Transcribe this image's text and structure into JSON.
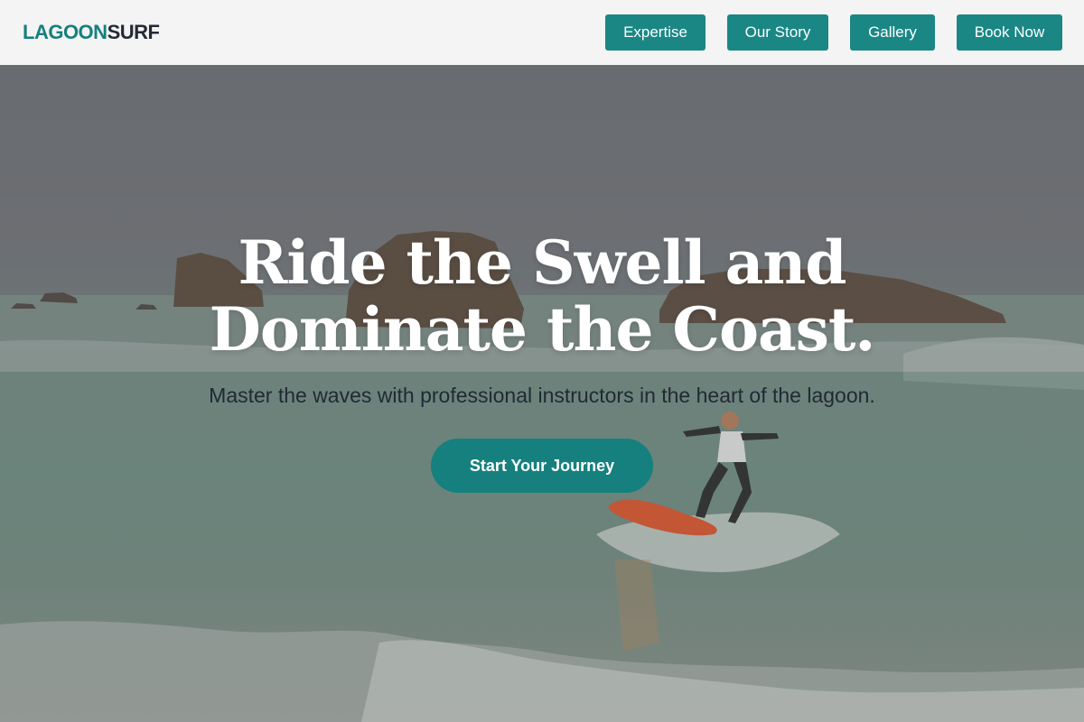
{
  "brand": {
    "part1": "LAGOON",
    "part2": "SURF"
  },
  "nav": {
    "items": [
      {
        "label": "Expertise"
      },
      {
        "label": "Our Story"
      },
      {
        "label": "Gallery"
      },
      {
        "label": "Book Now"
      }
    ]
  },
  "hero": {
    "headline_line1": "Ride the Swell and",
    "headline_line2": "Dominate the Coast.",
    "subheadline": "Master the waves with professional instructors in the heart of the lagoon.",
    "cta_label": "Start Your Journey",
    "image_subject": "surfer-on-wave-photo"
  },
  "colors": {
    "brand_teal": "#1a8785",
    "brand_dark": "#222b36",
    "header_bg": "#f4f4f4",
    "headline_text": "#ffffff",
    "subheadline_text": "#202a34"
  }
}
